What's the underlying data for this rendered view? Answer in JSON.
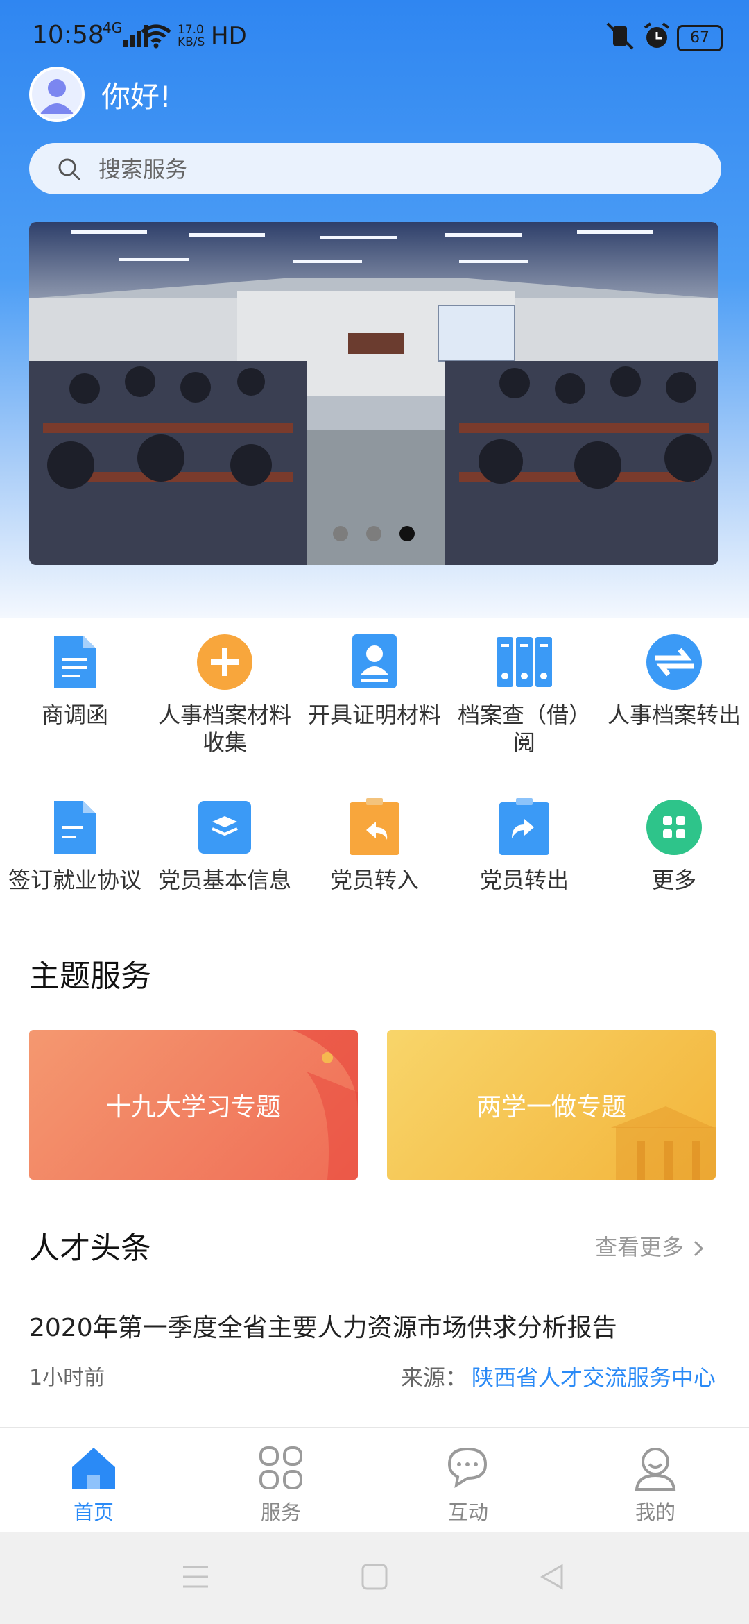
{
  "status_bar": {
    "time": "10:58",
    "network": "4G",
    "speed_value": "17.0",
    "speed_unit": "KB/S",
    "hd": "HD",
    "battery": "67"
  },
  "header": {
    "greeting": "你好!"
  },
  "search": {
    "placeholder": "搜索服务"
  },
  "banner": {
    "slide_count": 3,
    "active_slide": 3
  },
  "services": [
    {
      "label": "商调函",
      "icon": "document-icon"
    },
    {
      "label": "人事档案材料收集",
      "icon": "plus-circle-icon"
    },
    {
      "label": "开具证明材料",
      "icon": "id-card-icon"
    },
    {
      "label": "档案查（借）阅",
      "icon": "binders-icon"
    },
    {
      "label": "人事档案转出",
      "icon": "transfer-icon"
    },
    {
      "label": "签订就业协议",
      "icon": "document-icon"
    },
    {
      "label": "党员基本信息",
      "icon": "layers-icon"
    },
    {
      "label": "党员转入",
      "icon": "return-arrow-icon"
    },
    {
      "label": "党员转出",
      "icon": "forward-arrow-icon"
    },
    {
      "label": "更多",
      "icon": "grid-more-icon"
    }
  ],
  "theme_section": {
    "title": "主题服务",
    "cards": [
      {
        "label": "十九大学习专题",
        "color": "#f27a62"
      },
      {
        "label": "两学一做专题",
        "color": "#f6c24c"
      }
    ]
  },
  "news_section": {
    "title": "人才头条",
    "see_more": "查看更多",
    "items": [
      {
        "title": "2020年第一季度全省主要人力资源市场供求分析报告",
        "time": "1小时前",
        "source_label": "来源：",
        "source": "陕西省人才交流服务中心"
      }
    ]
  },
  "tab_bar": {
    "tabs": [
      {
        "label": "首页",
        "icon": "home-icon",
        "active": true
      },
      {
        "label": "服务",
        "icon": "services-grid-icon",
        "active": false
      },
      {
        "label": "互动",
        "icon": "chat-icon",
        "active": false
      },
      {
        "label": "我的",
        "icon": "profile-icon",
        "active": false
      }
    ]
  },
  "colors": {
    "accent": "#2a8af6",
    "header_top": "#2f86f1"
  }
}
